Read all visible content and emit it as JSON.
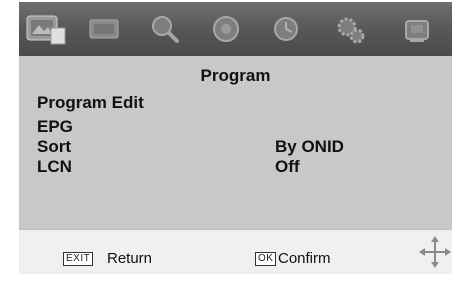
{
  "menu": {
    "title": "Program",
    "items": [
      {
        "label": "Program Edit",
        "value": ""
      },
      {
        "label": "EPG",
        "value": ""
      },
      {
        "label": "Sort",
        "value": "By ONID"
      },
      {
        "label": "LCN",
        "value": "Off"
      }
    ]
  },
  "footer": {
    "exit_key": "EXIT",
    "exit_label": "Return",
    "ok_key": "OK",
    "ok_label": "Confirm"
  },
  "icons": [
    "picture-icon",
    "screen-icon",
    "search-icon",
    "sound-icon",
    "time-icon",
    "settings-icon",
    "lock-icon",
    "navigation-arrows-icon"
  ]
}
